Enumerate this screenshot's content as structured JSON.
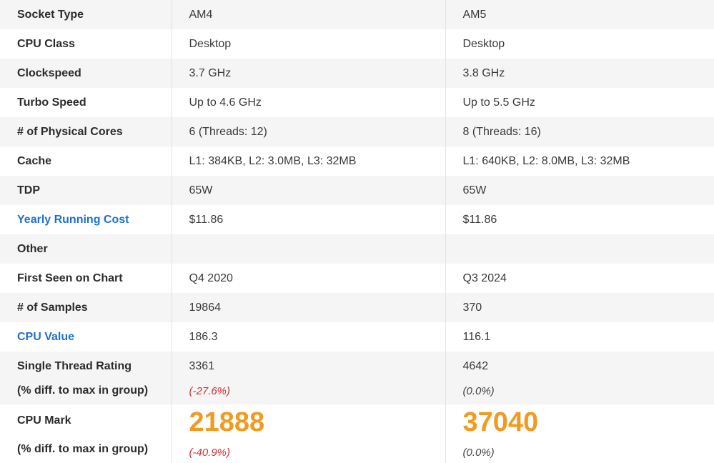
{
  "rows": [
    {
      "label": "Socket Type",
      "a": "AM4",
      "b": "AM5"
    },
    {
      "label": "CPU Class",
      "a": "Desktop",
      "b": "Desktop"
    },
    {
      "label": "Clockspeed",
      "a": "3.7 GHz",
      "b": "3.8 GHz"
    },
    {
      "label": "Turbo Speed",
      "a": "Up to 4.6 GHz",
      "b": "Up to 5.5 GHz"
    },
    {
      "label": "# of Physical Cores",
      "a": "6 (Threads: 12)",
      "b": "8 (Threads: 16)"
    },
    {
      "label": "Cache",
      "a": "L1: 384KB, L2: 3.0MB, L3: 32MB",
      "b": "L1: 640KB, L2: 8.0MB, L3: 32MB"
    },
    {
      "label": "TDP",
      "a": "65W",
      "b": "65W"
    },
    {
      "label": "Yearly Running Cost",
      "a": "$11.86",
      "b": "$11.86"
    },
    {
      "label": "Other",
      "a": "",
      "b": ""
    },
    {
      "label": "First Seen on Chart",
      "a": "Q4 2020",
      "b": "Q3 2024"
    },
    {
      "label": "# of Samples",
      "a": "19864",
      "b": "370"
    },
    {
      "label": "CPU Value",
      "a": "186.3",
      "b": "116.1"
    }
  ],
  "single_thread": {
    "label": "Single Thread Rating",
    "sublabel": "(% diff. to max in group)",
    "a": {
      "value": "3361",
      "diff": "(-27.6%)"
    },
    "b": {
      "value": "4642",
      "diff": "(0.0%)"
    }
  },
  "cpu_mark": {
    "label": "CPU Mark",
    "sublabel": "(% diff. to max in group)",
    "a": {
      "value": "21888",
      "diff": "(-40.9%)"
    },
    "b": {
      "value": "37040",
      "diff": "(0.0%)"
    }
  },
  "colors": {
    "link": "#1f6fd1",
    "mark": "#f39a1e",
    "negative": "#d0313a",
    "stripe": "#f5f5f5"
  }
}
